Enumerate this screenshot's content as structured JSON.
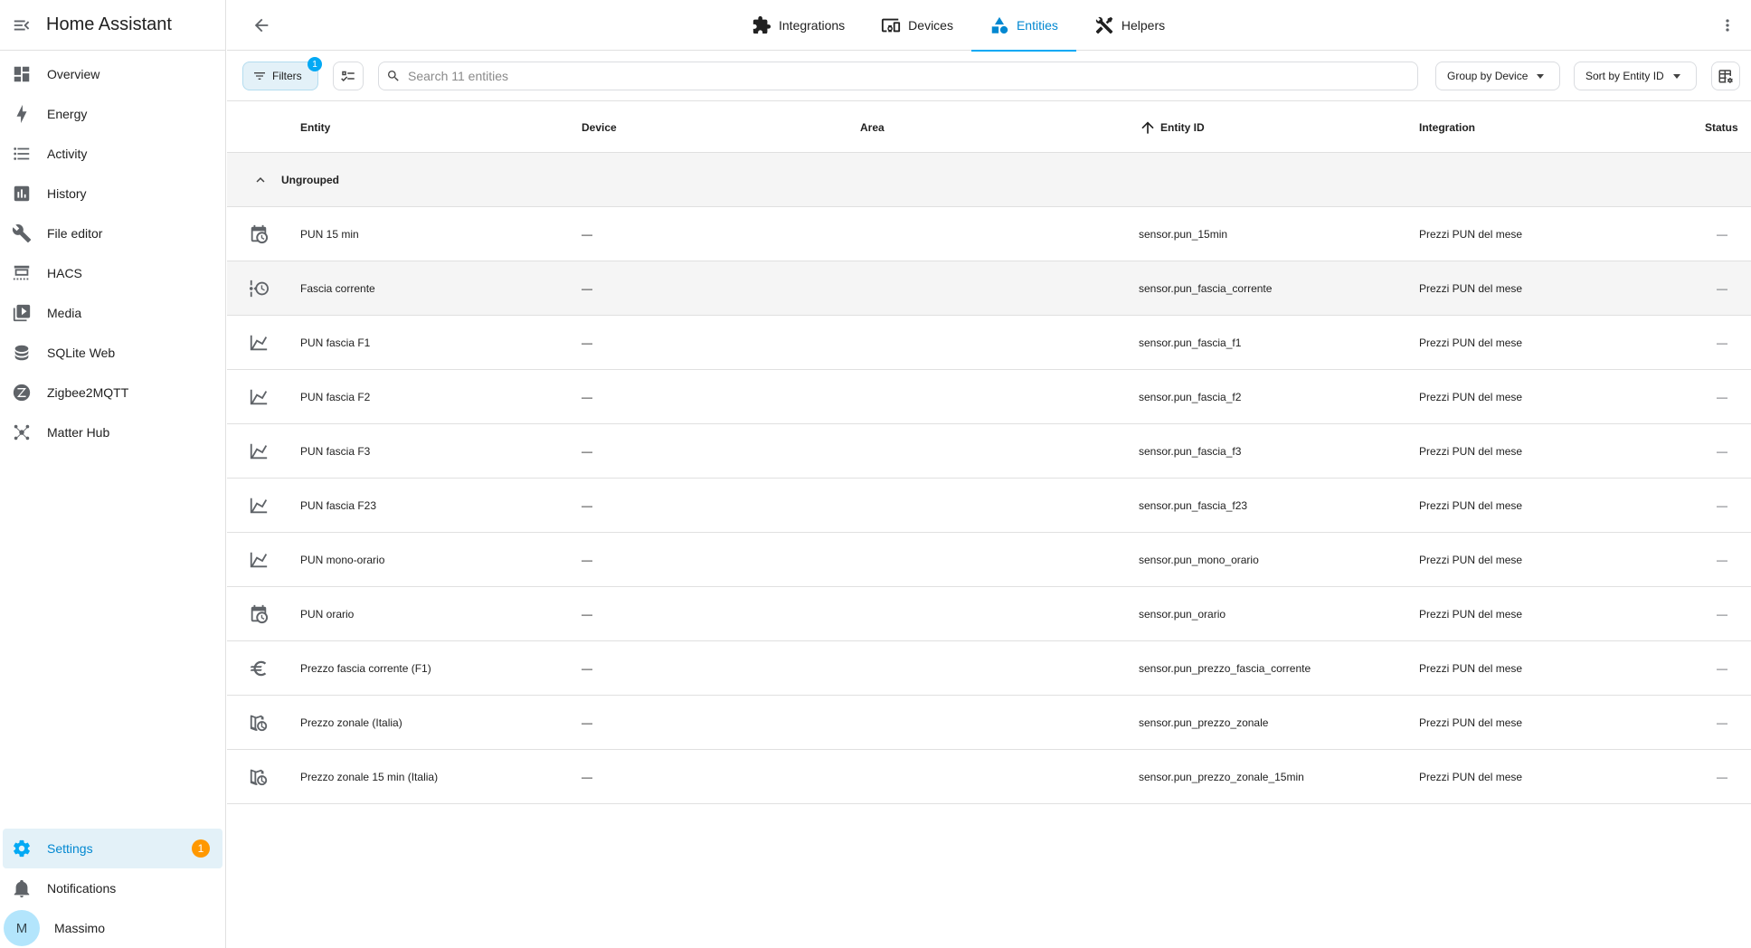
{
  "app": {
    "title": "Home Assistant"
  },
  "sidebar": {
    "items": [
      {
        "label": "Overview",
        "icon": "dashboard-icon"
      },
      {
        "label": "Energy",
        "icon": "lightning-icon"
      },
      {
        "label": "Activity",
        "icon": "list-icon"
      },
      {
        "label": "History",
        "icon": "chart-bar-icon"
      },
      {
        "label": "File editor",
        "icon": "wrench-icon"
      },
      {
        "label": "HACS",
        "icon": "hacs-icon"
      },
      {
        "label": "Media",
        "icon": "media-icon"
      },
      {
        "label": "SQLite Web",
        "icon": "database-icon"
      },
      {
        "label": "Zigbee2MQTT",
        "icon": "zigbee-icon"
      },
      {
        "label": "Matter Hub",
        "icon": "hub-icon"
      }
    ],
    "settings": {
      "label": "Settings",
      "badge": "1"
    },
    "notifications": {
      "label": "Notifications"
    },
    "user": {
      "initial": "M",
      "name": "Massimo"
    }
  },
  "tabs": [
    {
      "label": "Integrations",
      "icon": "puzzle-icon"
    },
    {
      "label": "Devices",
      "icon": "devices-icon"
    },
    {
      "label": "Entities",
      "icon": "shapes-icon",
      "active": true
    },
    {
      "label": "Helpers",
      "icon": "tools-icon"
    }
  ],
  "toolbar": {
    "filters_label": "Filters",
    "filters_count": "1",
    "search_placeholder": "Search 11 entities",
    "group_by": "Group by Device",
    "sort_by": "Sort by Entity ID"
  },
  "table": {
    "headers": {
      "entity": "Entity",
      "device": "Device",
      "area": "Area",
      "entity_id": "Entity ID",
      "integration": "Integration",
      "status": "Status"
    },
    "group_label": "Ungrouped",
    "rows": [
      {
        "icon": "calendar-clock-icon",
        "entity": "PUN 15 min",
        "device": "—",
        "entity_id": "sensor.pun_15min",
        "integration": "Prezzi PUN del mese",
        "status": "—"
      },
      {
        "icon": "timeline-clock-icon",
        "entity": "Fascia corrente",
        "device": "—",
        "entity_id": "sensor.pun_fascia_corrente",
        "integration": "Prezzi PUN del mese",
        "status": "—"
      },
      {
        "icon": "chart-line-icon",
        "entity": "PUN fascia F1",
        "device": "—",
        "entity_id": "sensor.pun_fascia_f1",
        "integration": "Prezzi PUN del mese",
        "status": "—"
      },
      {
        "icon": "chart-line-icon",
        "entity": "PUN fascia F2",
        "device": "—",
        "entity_id": "sensor.pun_fascia_f2",
        "integration": "Prezzi PUN del mese",
        "status": "—"
      },
      {
        "icon": "chart-line-icon",
        "entity": "PUN fascia F3",
        "device": "—",
        "entity_id": "sensor.pun_fascia_f3",
        "integration": "Prezzi PUN del mese",
        "status": "—"
      },
      {
        "icon": "chart-line-icon",
        "entity": "PUN fascia F23",
        "device": "—",
        "entity_id": "sensor.pun_fascia_f23",
        "integration": "Prezzi PUN del mese",
        "status": "—"
      },
      {
        "icon": "chart-line-icon",
        "entity": "PUN mono-orario",
        "device": "—",
        "entity_id": "sensor.pun_mono_orario",
        "integration": "Prezzi PUN del mese",
        "status": "—"
      },
      {
        "icon": "calendar-clock-icon",
        "entity": "PUN orario",
        "device": "—",
        "entity_id": "sensor.pun_orario",
        "integration": "Prezzi PUN del mese",
        "status": "—"
      },
      {
        "icon": "euro-icon",
        "entity": "Prezzo fascia corrente (F1)",
        "device": "—",
        "entity_id": "sensor.pun_prezzo_fascia_corrente",
        "integration": "Prezzi PUN del mese",
        "status": "—"
      },
      {
        "icon": "map-clock-icon",
        "entity": "Prezzo zonale (Italia)",
        "device": "—",
        "entity_id": "sensor.pun_prezzo_zonale",
        "integration": "Prezzi PUN del mese",
        "status": "—"
      },
      {
        "icon": "map-clock-icon",
        "entity": "Prezzo zonale 15 min (Italia)",
        "device": "—",
        "entity_id": "sensor.pun_prezzo_zonale_15min",
        "integration": "Prezzi PUN del mese",
        "status": "—"
      }
    ]
  },
  "colors": {
    "accent": "#03a9f4",
    "accent_dark": "#0288d1",
    "badge": "#ff9800",
    "selected_bg": "#e3f1f8"
  }
}
